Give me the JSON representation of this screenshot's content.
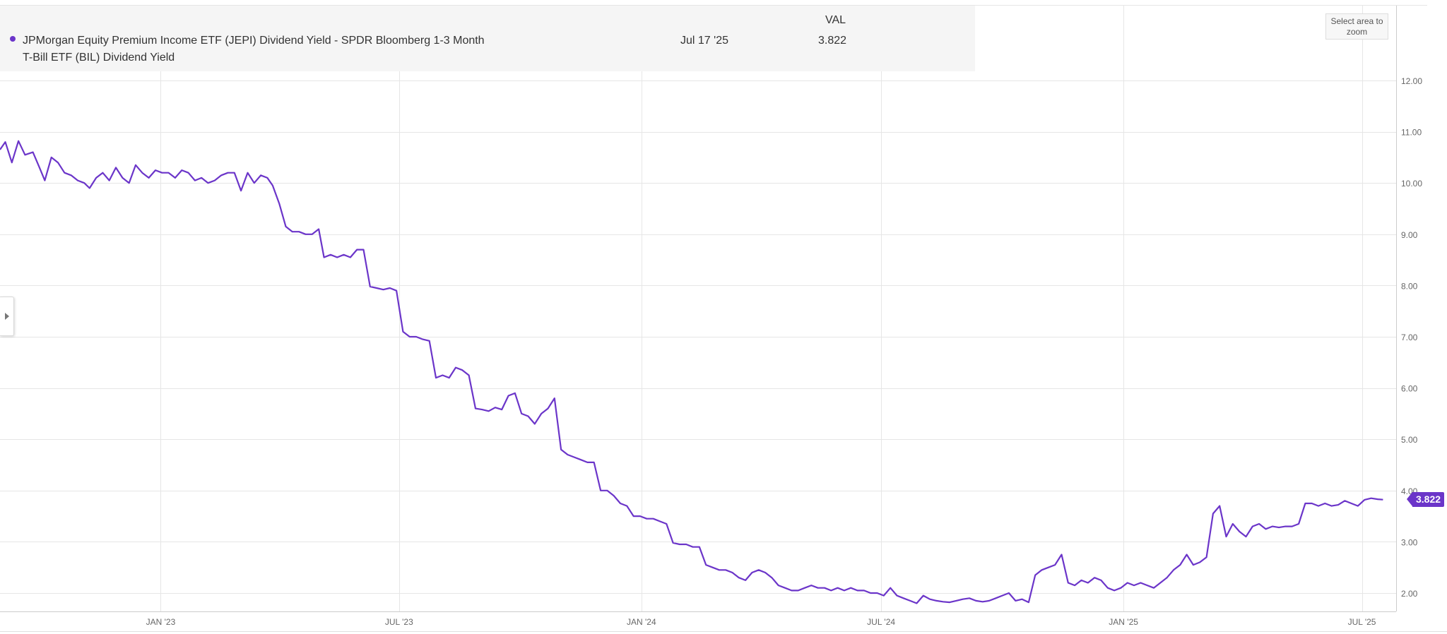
{
  "legend": {
    "column_header": "VAL",
    "series_name": "JPMorgan Equity Premium Income ETF (JEPI) Dividend Yield - SPDR Bloomberg 1-3 Month T-Bill ETF (BIL) Dividend Yield",
    "date": "Jul 17 '25",
    "value": "3.822"
  },
  "zoom_button_label": "Select area to zoom",
  "last_value_label": "3.822",
  "colors": {
    "series": "#6b35c9",
    "grid": "#e6e6e6",
    "axis_text": "#666666",
    "legend_bg": "#f5f5f5"
  },
  "icons": {
    "panel_toggle": "triangle-right-icon",
    "legend_marker": "dot-icon"
  },
  "chart_data": {
    "type": "line",
    "title": "",
    "xlabel": "",
    "ylabel": "",
    "x_range": [
      "2022-09-01",
      "2025-07-27"
    ],
    "ylim": [
      1.7,
      12.8
    ],
    "y_ticks": [
      2.0,
      3.0,
      4.0,
      5.0,
      6.0,
      7.0,
      8.0,
      9.0,
      10.0,
      11.0,
      12.0
    ],
    "y_tick_labels": [
      "2.00",
      "3.00",
      "4.00",
      "5.00",
      "6.00",
      "7.00",
      "8.00",
      "9.00",
      "10.00",
      "11.00",
      "12.00"
    ],
    "x_ticks": [
      "2023-01-01",
      "2023-07-01",
      "2024-01-01",
      "2024-07-01",
      "2025-01-01",
      "2025-07-01"
    ],
    "x_tick_labels": [
      "JAN '23",
      "JUL '23",
      "JAN '24",
      "JUL '24",
      "JAN '25",
      "JUL '25"
    ],
    "grid": true,
    "legend_position": "top-left",
    "series": [
      {
        "name": "JPMorgan Equity Premium Income ETF (JEPI) Dividend Yield - SPDR Bloomberg 1-3 Month T-Bill ETF (BIL) Dividend Yield",
        "x": [
          "2022-09-01",
          "2022-09-05",
          "2022-09-10",
          "2022-09-15",
          "2022-09-20",
          "2022-09-26",
          "2022-10-01",
          "2022-10-05",
          "2022-10-10",
          "2022-10-15",
          "2022-10-20",
          "2022-10-25",
          "2022-10-30",
          "2022-11-04",
          "2022-11-08",
          "2022-11-13",
          "2022-11-18",
          "2022-11-23",
          "2022-11-28",
          "2022-12-03",
          "2022-12-08",
          "2022-12-13",
          "2022-12-18",
          "2022-12-23",
          "2022-12-28",
          "2023-01-02",
          "2023-01-07",
          "2023-01-12",
          "2023-01-17",
          "2023-01-22",
          "2023-01-27",
          "2023-02-01",
          "2023-02-06",
          "2023-02-11",
          "2023-02-16",
          "2023-02-21",
          "2023-02-26",
          "2023-03-03",
          "2023-03-08",
          "2023-03-13",
          "2023-03-18",
          "2023-03-23",
          "2023-03-27",
          "2023-04-01",
          "2023-04-06",
          "2023-04-11",
          "2023-04-16",
          "2023-04-21",
          "2023-04-26",
          "2023-05-01",
          "2023-05-05",
          "2023-05-10",
          "2023-05-15",
          "2023-05-20",
          "2023-05-25",
          "2023-05-30",
          "2023-06-04",
          "2023-06-09",
          "2023-06-14",
          "2023-06-19",
          "2023-06-24",
          "2023-06-29",
          "2023-07-04",
          "2023-07-09",
          "2023-07-14",
          "2023-07-19",
          "2023-07-24",
          "2023-07-29",
          "2023-08-03",
          "2023-08-08",
          "2023-08-13",
          "2023-08-18",
          "2023-08-23",
          "2023-08-28",
          "2023-09-02",
          "2023-09-07",
          "2023-09-12",
          "2023-09-17",
          "2023-09-22",
          "2023-09-27",
          "2023-10-02",
          "2023-10-07",
          "2023-10-12",
          "2023-10-17",
          "2023-10-22",
          "2023-10-27",
          "2023-11-01",
          "2023-11-06",
          "2023-11-11",
          "2023-11-16",
          "2023-11-21",
          "2023-11-26",
          "2023-12-01",
          "2023-12-06",
          "2023-12-11",
          "2023-12-16",
          "2023-12-21",
          "2023-12-26",
          "2023-12-31",
          "2024-01-05",
          "2024-01-10",
          "2024-01-15",
          "2024-01-20",
          "2024-01-25",
          "2024-01-30",
          "2024-02-04",
          "2024-02-09",
          "2024-02-14",
          "2024-02-19",
          "2024-02-24",
          "2024-02-29",
          "2024-03-05",
          "2024-03-10",
          "2024-03-15",
          "2024-03-20",
          "2024-03-25",
          "2024-03-30",
          "2024-04-04",
          "2024-04-09",
          "2024-04-14",
          "2024-04-19",
          "2024-04-24",
          "2024-04-29",
          "2024-05-04",
          "2024-05-09",
          "2024-05-14",
          "2024-05-19",
          "2024-05-24",
          "2024-05-29",
          "2024-06-03",
          "2024-06-08",
          "2024-06-13",
          "2024-06-18",
          "2024-06-23",
          "2024-06-28",
          "2024-07-03",
          "2024-07-08",
          "2024-07-13",
          "2024-07-18",
          "2024-07-23",
          "2024-07-28",
          "2024-08-02",
          "2024-08-07",
          "2024-08-12",
          "2024-08-17",
          "2024-08-22",
          "2024-08-27",
          "2024-09-01",
          "2024-09-06",
          "2024-09-11",
          "2024-09-16",
          "2024-09-21",
          "2024-09-26",
          "2024-10-01",
          "2024-10-06",
          "2024-10-11",
          "2024-10-16",
          "2024-10-21",
          "2024-10-26",
          "2024-10-31",
          "2024-11-05",
          "2024-11-10",
          "2024-11-15",
          "2024-11-20",
          "2024-11-25",
          "2024-11-30",
          "2024-12-05",
          "2024-12-10",
          "2024-12-15",
          "2024-12-20",
          "2024-12-25",
          "2024-12-30",
          "2025-01-04",
          "2025-01-09",
          "2025-01-14",
          "2025-01-19",
          "2025-01-24",
          "2025-01-29",
          "2025-02-03",
          "2025-02-08",
          "2025-02-13",
          "2025-02-18",
          "2025-02-23",
          "2025-02-28",
          "2025-03-05",
          "2025-03-10",
          "2025-03-15",
          "2025-03-20",
          "2025-03-25",
          "2025-03-30",
          "2025-04-04",
          "2025-04-09",
          "2025-04-14",
          "2025-04-19",
          "2025-04-24",
          "2025-04-29",
          "2025-05-04",
          "2025-05-09",
          "2025-05-14",
          "2025-05-19",
          "2025-05-24",
          "2025-05-29",
          "2025-06-03",
          "2025-06-08",
          "2025-06-13",
          "2025-06-18",
          "2025-06-23",
          "2025-06-28",
          "2025-07-03",
          "2025-07-08",
          "2025-07-13",
          "2025-07-17"
        ],
        "values": [
          10.65,
          10.8,
          10.4,
          10.82,
          10.55,
          10.6,
          10.3,
          10.05,
          10.5,
          10.4,
          10.2,
          10.15,
          10.05,
          10.0,
          9.9,
          10.1,
          10.2,
          10.05,
          10.3,
          10.1,
          10.0,
          10.35,
          10.2,
          10.1,
          10.25,
          10.2,
          10.2,
          10.1,
          10.25,
          10.2,
          10.05,
          10.1,
          10.0,
          10.05,
          10.15,
          10.2,
          10.2,
          9.85,
          10.2,
          10.0,
          10.15,
          10.1,
          9.95,
          9.6,
          9.15,
          9.05,
          9.05,
          9.0,
          9.0,
          9.1,
          8.55,
          8.6,
          8.55,
          8.6,
          8.55,
          8.7,
          8.7,
          7.98,
          7.95,
          7.92,
          7.95,
          7.9,
          7.1,
          7.0,
          7.0,
          6.95,
          6.92,
          6.2,
          6.25,
          6.2,
          6.4,
          6.35,
          6.25,
          5.6,
          5.58,
          5.55,
          5.62,
          5.58,
          5.85,
          5.9,
          5.5,
          5.45,
          5.3,
          5.5,
          5.6,
          5.8,
          4.8,
          4.7,
          4.65,
          4.6,
          4.55,
          4.55,
          4.0,
          4.0,
          3.9,
          3.75,
          3.7,
          3.5,
          3.5,
          3.45,
          3.45,
          3.4,
          3.35,
          2.98,
          2.95,
          2.95,
          2.9,
          2.9,
          2.55,
          2.5,
          2.45,
          2.45,
          2.4,
          2.3,
          2.25,
          2.4,
          2.45,
          2.4,
          2.3,
          2.15,
          2.1,
          2.05,
          2.05,
          2.1,
          2.15,
          2.1,
          2.1,
          2.05,
          2.1,
          2.05,
          2.1,
          2.05,
          2.05,
          2.0,
          2.0,
          1.95,
          2.1,
          1.95,
          1.9,
          1.85,
          1.8,
          1.95,
          1.88,
          1.85,
          1.83,
          1.82,
          1.85,
          1.88,
          1.9,
          1.85,
          1.83,
          1.85,
          1.9,
          1.95,
          2.0,
          1.85,
          1.88,
          1.82,
          2.35,
          2.45,
          2.5,
          2.55,
          2.75,
          2.2,
          2.15,
          2.25,
          2.2,
          2.3,
          2.25,
          2.1,
          2.05,
          2.1,
          2.2,
          2.15,
          2.2,
          2.15,
          2.1,
          2.2,
          2.3,
          2.45,
          2.55,
          2.75,
          2.55,
          2.6,
          2.7,
          3.55,
          3.7,
          3.1,
          3.35,
          3.2,
          3.1,
          3.3,
          3.35,
          3.25,
          3.3,
          3.28,
          3.3,
          3.3,
          3.35,
          3.75,
          3.75,
          3.7,
          3.75,
          3.7,
          3.72,
          3.8,
          3.75,
          3.7,
          3.82,
          3.85,
          3.83,
          3.822
        ]
      }
    ]
  }
}
